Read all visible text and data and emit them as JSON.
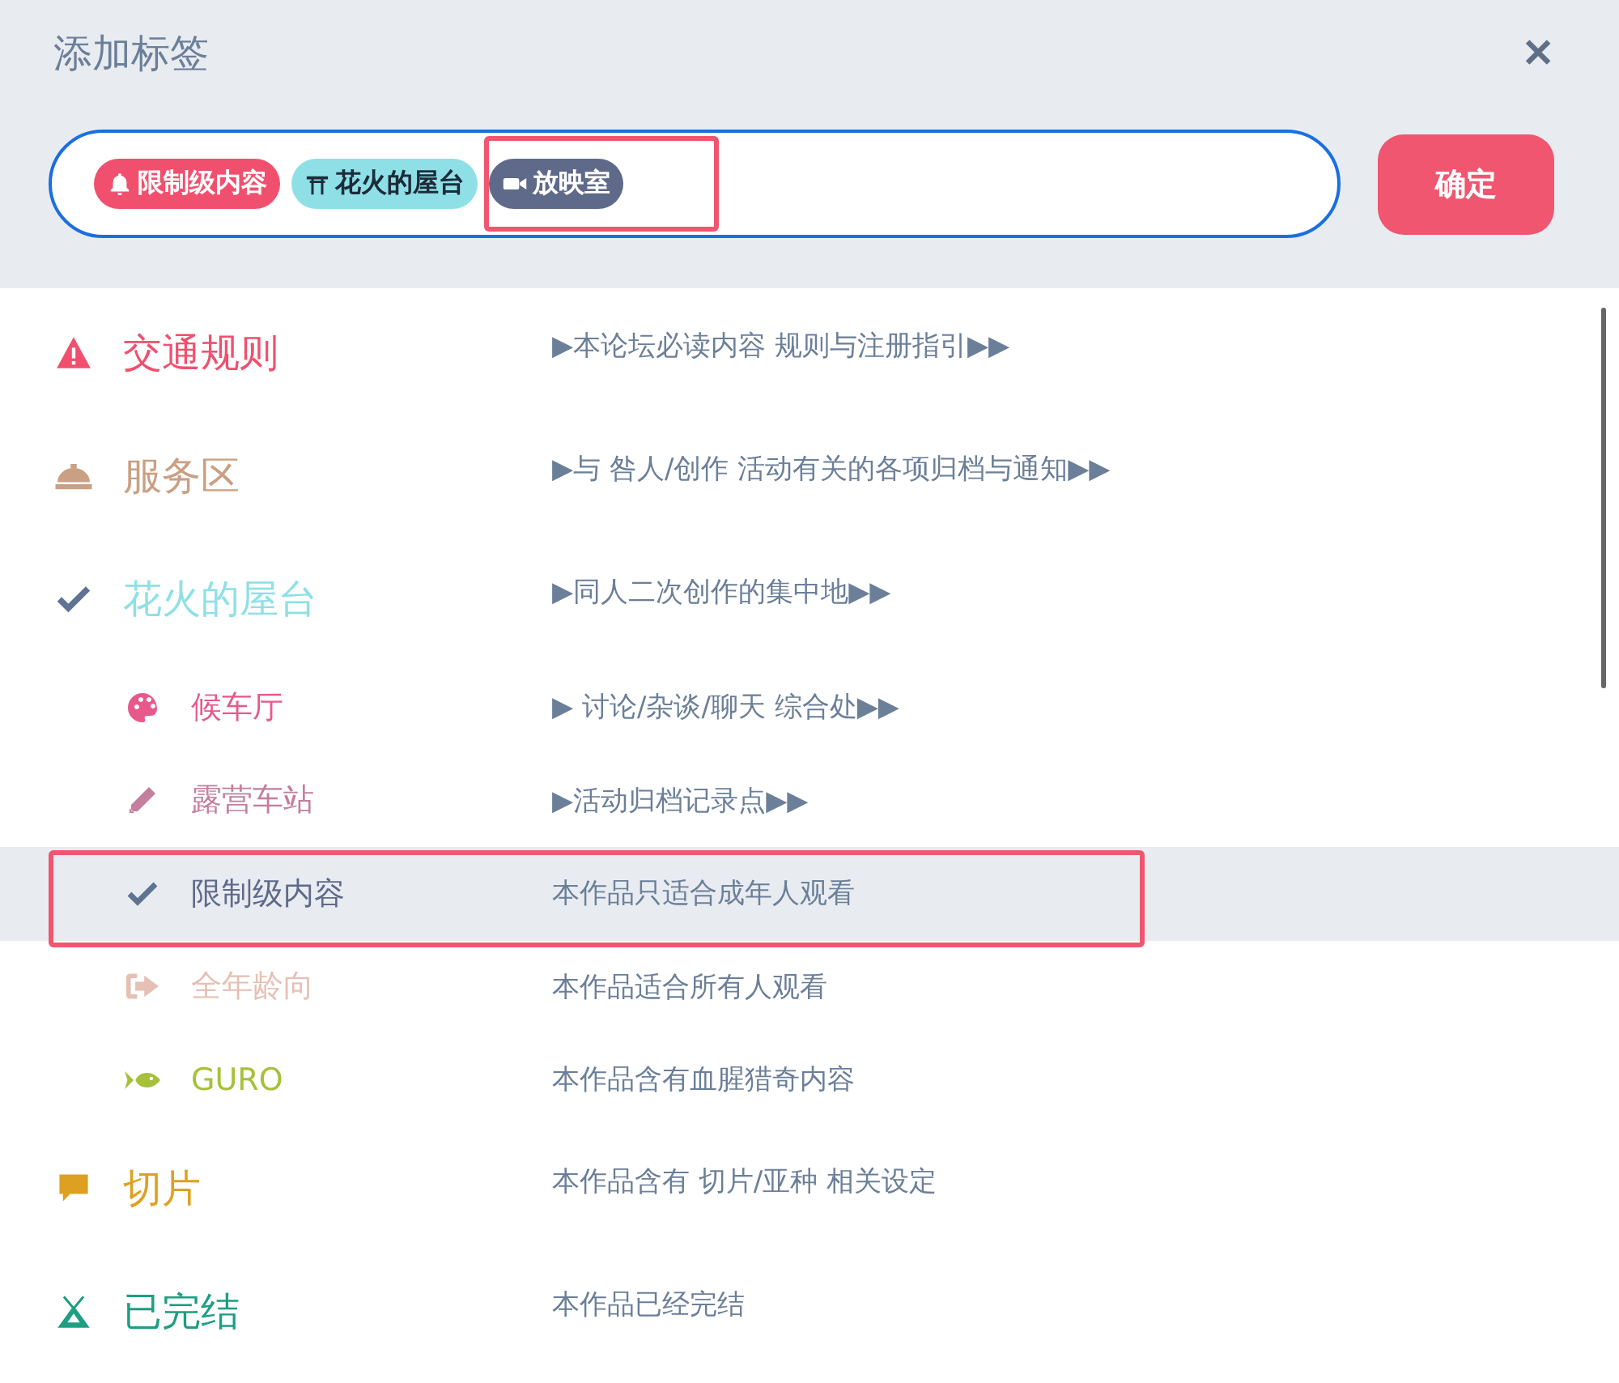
{
  "dialog": {
    "title": "添加标签",
    "close": "✕"
  },
  "tags": [
    {
      "label": "限制级内容",
      "color": "#f0506e",
      "annotated": false
    },
    {
      "label": "花火的屋台",
      "color": "#8ee0e6",
      "annotated": false
    },
    {
      "label": "放映室",
      "color": "#5f6a8a",
      "annotated": true
    }
  ],
  "confirm_button": "确定",
  "items": [
    {
      "label": "交通规则",
      "description": "▶本论坛必读内容 规则与注册指引▶▶",
      "color": "#f0506e",
      "checked": false,
      "selected": false,
      "annotated": false
    },
    {
      "label": "服务区",
      "description": "▶与 咎人/创作 活动有关的各项归档与通知▶▶",
      "color": "#c9a084",
      "checked": false,
      "selected": false,
      "annotated": false
    },
    {
      "label": "花火的屋台",
      "description": "▶同人二次创作的集中地▶▶",
      "color": "#8ee0e6",
      "checked": true,
      "selected": false,
      "annotated": false,
      "children": [
        {
          "label": "候车厅",
          "description": "▶ 讨论/杂谈/聊天 综合处▶▶",
          "color": "#e8588a",
          "checked": false,
          "selected": false,
          "annotated": false
        },
        {
          "label": "露营车站",
          "description": "▶活动归档记录点▶▶",
          "color": "#c47e9e",
          "checked": false,
          "selected": false,
          "annotated": false
        },
        {
          "label": "限制级内容",
          "description": "本作品只适合成年人观看",
          "color": "#5f6a8a",
          "checked": true,
          "selected": true,
          "annotated": true
        },
        {
          "label": "全年龄向",
          "description": "本作品适合所有人观看",
          "color": "#e6c0b4",
          "checked": false,
          "selected": false,
          "annotated": false
        },
        {
          "label": "GURO",
          "description": "本作品含有血腥猎奇内容",
          "color": "#a6c03a",
          "checked": false,
          "selected": false,
          "annotated": false
        }
      ]
    },
    {
      "label": "切片",
      "description": "本作品含有 切片/亚种 相关设定",
      "color": "#dea020",
      "checked": false,
      "selected": false,
      "annotated": false
    },
    {
      "label": "已完结",
      "description": "本作品已经完结",
      "color": "#1e9e82",
      "checked": false,
      "selected": false,
      "annotated": false
    }
  ]
}
